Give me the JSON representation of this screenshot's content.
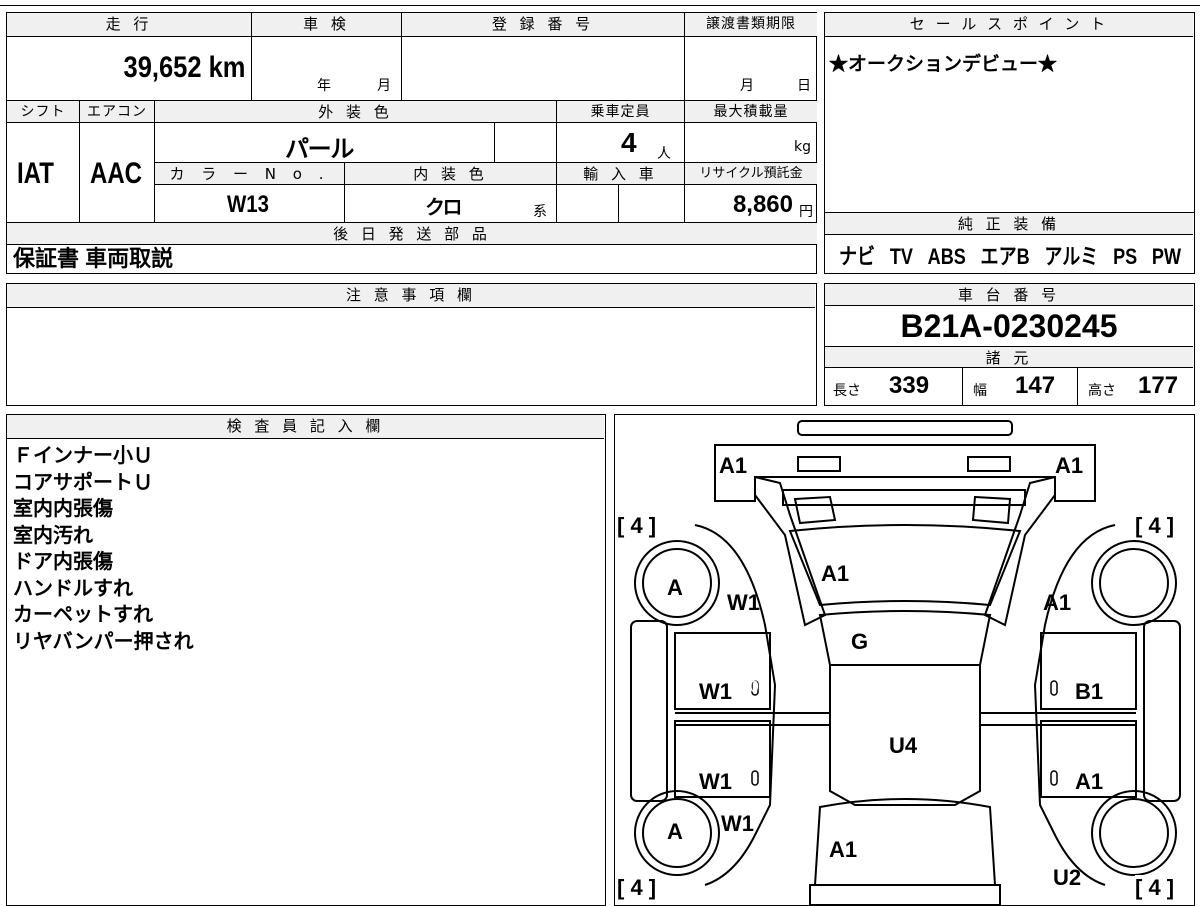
{
  "vehicle": {
    "mileage_label": "走 行",
    "mileage": "39,652 km",
    "inspection_label": "車 検",
    "inspection_year": "年",
    "inspection_month": "月",
    "registration_label": "登 録 番 号",
    "transfer_label": "譲渡書類期限",
    "transfer_month": "月",
    "transfer_day": "日",
    "shift_label": "シフト",
    "shift": "IAT",
    "aircon_label": "エアコン",
    "aircon": "AAC",
    "exterior_label": "外 装 色",
    "exterior": "パ ー ル",
    "capacity_label": "乗車定員",
    "capacity": "4",
    "capacity_unit": "人",
    "maxload_label": "最大積載量",
    "maxload_unit": "kg",
    "color_no_label": "カ ラ ー N o .",
    "color_no": "W13",
    "interior_label": "内 装 色",
    "interior": "ク ロ",
    "interior_suffix": "系",
    "import_label": "輸 入 車",
    "recycle_label": "リサイクル預託金",
    "recycle": "8,860",
    "recycle_unit": "円",
    "later_parts_label": "後 日 発 送 部 品",
    "later_parts": "保証書 車両取説"
  },
  "sales": {
    "label": "セ ー ル ス ポ イ ン ト",
    "text": "★オークションデビュー★"
  },
  "equipment": {
    "label": "純 正 装 備",
    "items": [
      "ナビ",
      "TV",
      "ABS",
      "エアB",
      "アルミ",
      "PS",
      "PW"
    ]
  },
  "notes": {
    "label": "注 意 事 項 欄"
  },
  "chassis": {
    "label": "車 台 番 号",
    "number": "B21A-0230245",
    "specs_label": "諸 元",
    "length_label": "長さ",
    "length": "339",
    "width_label": "幅",
    "width": "147",
    "height_label": "高さ",
    "height": "177"
  },
  "inspector": {
    "label": "検 査 員 記 入 欄",
    "lines": [
      "Ｆインナー小Ｕ",
      "コアサポートＵ",
      "室内内張傷",
      "室内汚れ",
      "ドア内張傷",
      "ハンドルすれ",
      "カーペットすれ",
      "リヤバンパー押され"
    ]
  },
  "diagram": {
    "tire_top_left": "[ 4 ]",
    "tire_top_right": "[ 4 ]",
    "tire_bottom_left": "[ 4 ]",
    "tire_bottom_right": "[ 4 ]",
    "a1_top_left": "A1",
    "a1_top_right": "A1",
    "hood": "A1",
    "wheel_front_left": "A",
    "fender_left": "W1",
    "fender_right": "A1",
    "windshield": "G",
    "door_front_left": "W1",
    "door_front_right": "B1",
    "door_rear_left": "W1",
    "door_rear_right": "A1",
    "roof": "U4",
    "wheel_rear_left": "A",
    "quarter_left": "W1",
    "rear_center": "A1",
    "rear_right": "U2",
    "zero": "0"
  }
}
